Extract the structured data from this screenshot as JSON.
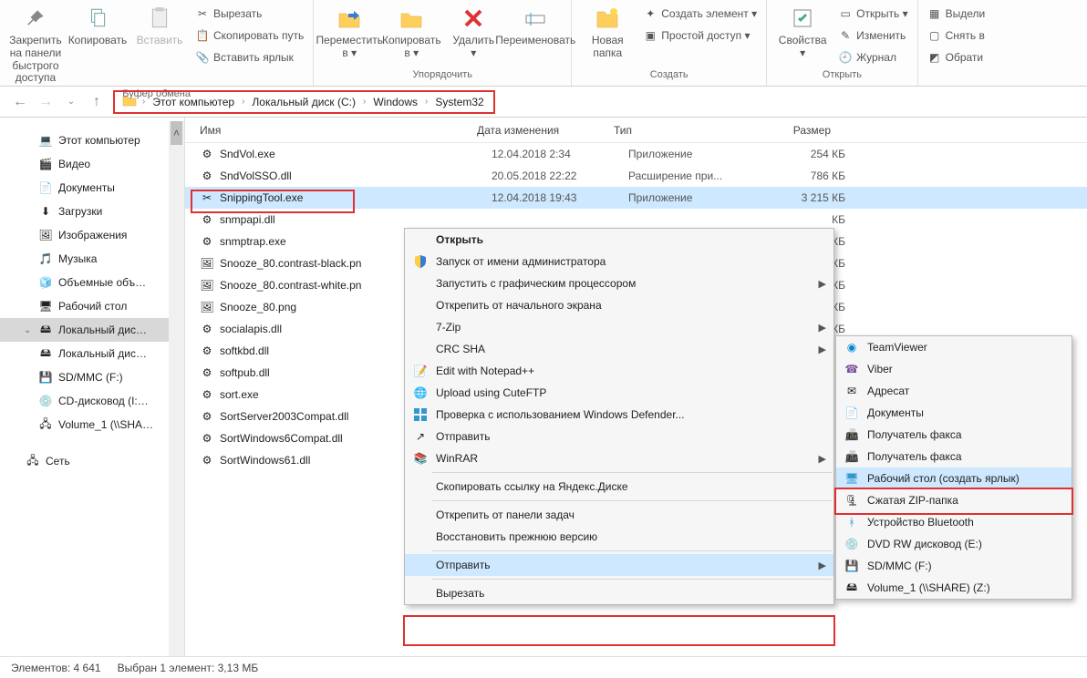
{
  "ribbon": {
    "pin": {
      "l1": "Закрепить на панели",
      "l2": "быстрого доступа"
    },
    "copy": "Копировать",
    "paste": "Вставить",
    "cut": "Вырезать",
    "copy_path": "Скопировать путь",
    "paste_shortcut": "Вставить ярлык",
    "group_clipboard": "Буфер обмена",
    "move_to": {
      "l1": "Переместить",
      "l2": "в ▾"
    },
    "copy_to": {
      "l1": "Копировать",
      "l2": "в ▾"
    },
    "delete": {
      "l1": "Удалить",
      "l2": "▾"
    },
    "rename": "Переименовать",
    "group_organize": "Упорядочить",
    "new_folder": {
      "l1": "Новая",
      "l2": "папка"
    },
    "new_item": "Создать элемент ▾",
    "easy_access": "Простой доступ ▾",
    "group_new": "Создать",
    "properties": {
      "l1": "Свойства",
      "l2": "▾"
    },
    "open": "Открыть ▾",
    "edit": "Изменить",
    "history": "Журнал",
    "group_open": "Открыть",
    "select_all": "Выдели",
    "select_none": "Снять в",
    "invert": "Обрати"
  },
  "breadcrumb": [
    "Этот компьютер",
    "Локальный диск (C:)",
    "Windows",
    "System32"
  ],
  "sidebar": [
    {
      "icon": "pc",
      "label": "Этот компьютер"
    },
    {
      "icon": "video",
      "label": "Видео"
    },
    {
      "icon": "doc",
      "label": "Документы"
    },
    {
      "icon": "dl",
      "label": "Загрузки"
    },
    {
      "icon": "img",
      "label": "Изображения"
    },
    {
      "icon": "music",
      "label": "Музыка"
    },
    {
      "icon": "3d",
      "label": "Объемные объ…"
    },
    {
      "icon": "desk",
      "label": "Рабочий стол"
    },
    {
      "icon": "disk",
      "label": "Локальный дис…",
      "sel": true,
      "exp": true
    },
    {
      "icon": "disk",
      "label": "Локальный дис…"
    },
    {
      "icon": "sd",
      "label": "SD/MMC (F:)"
    },
    {
      "icon": "cd",
      "label": "CD-дисковод (I:…"
    },
    {
      "icon": "net",
      "label": "Volume_1 (\\\\SHA…"
    }
  ],
  "sidebar_network": "Сеть",
  "columns": {
    "name": "Имя",
    "date": "Дата изменения",
    "type": "Тип",
    "size": "Размер"
  },
  "files": [
    {
      "icon": "app",
      "name": "SndVol.exe",
      "date": "12.04.2018 2:34",
      "type": "Приложение",
      "size": "254 КБ"
    },
    {
      "icon": "dll",
      "name": "SndVolSSO.dll",
      "date": "20.05.2018 22:22",
      "type": "Расширение при...",
      "size": "786 КБ"
    },
    {
      "icon": "snip",
      "name": "SnippingTool.exe",
      "date": "12.04.2018 19:43",
      "type": "Приложение",
      "size": "3 215 КБ",
      "sel": true
    },
    {
      "icon": "dll",
      "name": "snmpapi.dll",
      "date": "",
      "type": "",
      "size": "КБ"
    },
    {
      "icon": "app",
      "name": "snmptrap.exe",
      "date": "",
      "type": "",
      "size": "КБ"
    },
    {
      "icon": "png",
      "name": "Snooze_80.contrast-black.pn",
      "date": "",
      "type": "",
      "size": "КБ"
    },
    {
      "icon": "png",
      "name": "Snooze_80.contrast-white.pn",
      "date": "",
      "type": "",
      "size": "КБ"
    },
    {
      "icon": "png",
      "name": "Snooze_80.png",
      "date": "",
      "type": "",
      "size": "КБ"
    },
    {
      "icon": "dll",
      "name": "socialapis.dll",
      "date": "",
      "type": "",
      "size": "КБ"
    },
    {
      "icon": "dll",
      "name": "softkbd.dll",
      "date": "",
      "type": "",
      "size": ""
    },
    {
      "icon": "dll",
      "name": "softpub.dll",
      "date": "",
      "type": "",
      "size": ""
    },
    {
      "icon": "app",
      "name": "sort.exe",
      "date": "",
      "type": "",
      "size": ""
    },
    {
      "icon": "dll",
      "name": "SortServer2003Compat.dll",
      "date": "",
      "type": "",
      "size": ""
    },
    {
      "icon": "dll",
      "name": "SortWindows6Compat.dll",
      "date": "",
      "type": "",
      "size": ""
    },
    {
      "icon": "dll",
      "name": "SortWindows61.dll",
      "date": "",
      "type": "",
      "size": ""
    }
  ],
  "status": {
    "items": "Элементов: 4 641",
    "selected": "Выбран 1 элемент: 3,13 МБ"
  },
  "ctx1": {
    "open": "Открыть",
    "runas": "Запуск от имени администратора",
    "gpu": "Запустить с графическим процессором",
    "unpin_start": "Открепить от начального экрана",
    "7zip": "7-Zip",
    "crc": "CRC SHA",
    "notepad": "Edit with Notepad++",
    "cuteftp": "Upload using CuteFTP",
    "defender": "Проверка с использованием Windows Defender...",
    "share": "Отправить",
    "winrar": "WinRAR",
    "yandex": "Скопировать ссылку на Яндекс.Диске",
    "unpin_tb": "Открепить от панели задач",
    "restore": "Восстановить прежнюю версию",
    "send": "Отправить",
    "cut": "Вырезать"
  },
  "ctx2": {
    "teamviewer": "TeamViewer",
    "viber": "Viber",
    "recipient": "Адресат",
    "docs": "Документы",
    "fax1": "Получатель факса",
    "fax2": "Получатель факса",
    "desktop": "Рабочий стол (создать ярлык)",
    "zip": "Сжатая ZIP-папка",
    "bluetooth": "Устройство Bluetooth",
    "dvd": "DVD RW дисковод (E:)",
    "sd": "SD/MMC (F:)",
    "vol": "Volume_1 (\\\\SHARE) (Z:)"
  }
}
